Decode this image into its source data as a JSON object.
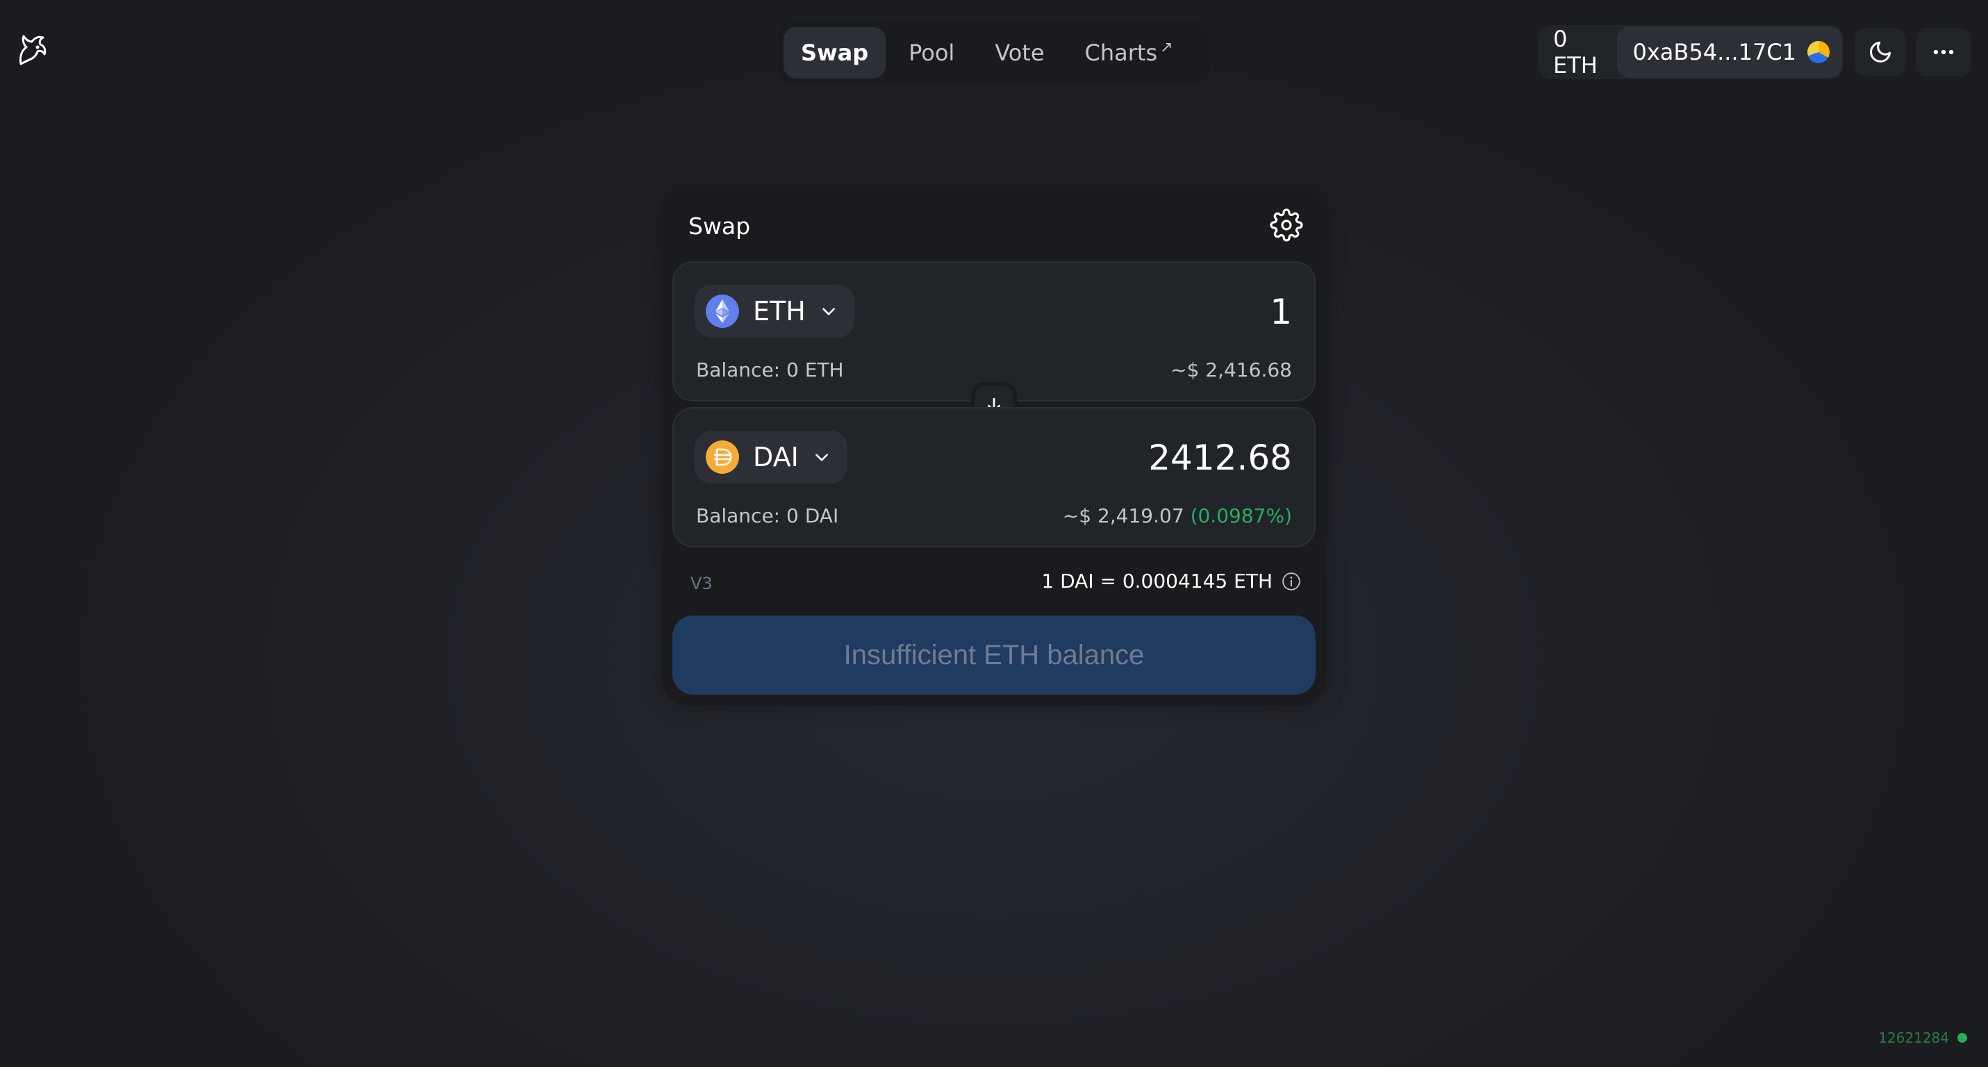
{
  "header": {
    "nav": [
      {
        "label": "Swap",
        "active": true
      },
      {
        "label": "Pool",
        "active": false
      },
      {
        "label": "Vote",
        "active": false
      },
      {
        "label": "Charts",
        "external_marker": "↗"
      }
    ],
    "account": {
      "eth_balance": "0 ETH",
      "address": "0xaB54...17C1"
    },
    "icons": {
      "logo": "unicorn-logo-icon",
      "theme": "moon-icon",
      "menu": "more-dots-icon"
    }
  },
  "swap": {
    "title": "Swap",
    "input": {
      "token": "ETH",
      "token_color": "#627eea",
      "amount": "1",
      "balance": "Balance: 0 ETH",
      "usd_value": "~$ 2,416.68"
    },
    "output": {
      "token": "DAI",
      "token_color": "#f5ac37",
      "amount": "2412.68",
      "balance": "Balance: 0 DAI",
      "usd_value": "~$ 2,419.07",
      "price_impact": "(0.0987%)"
    },
    "version": "V3",
    "rate": "1 DAI = 0.0004145 ETH",
    "cta_label": "Insufficient ETH balance"
  },
  "footer": {
    "block_number": "12621284",
    "status_color": "#27ae60"
  }
}
